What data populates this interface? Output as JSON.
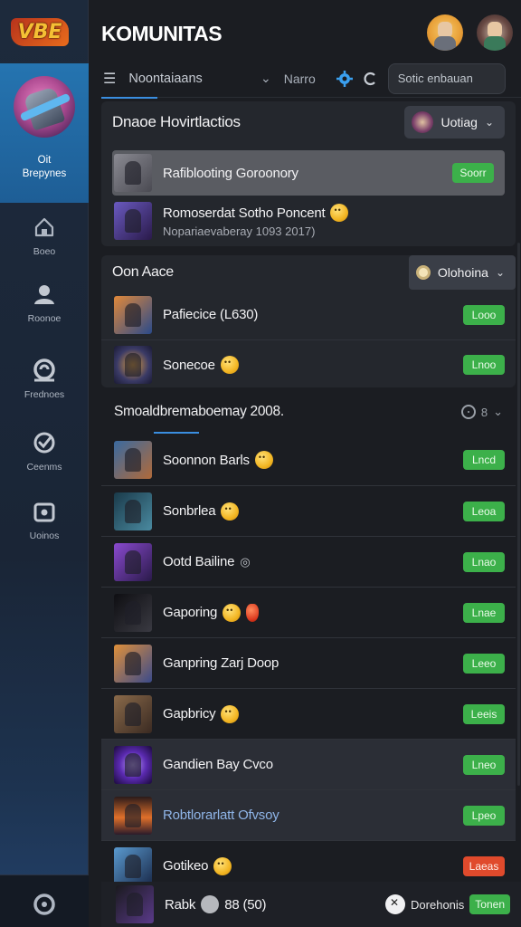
{
  "app": {
    "logo_text": "VBE",
    "title": "KOMUNITAS"
  },
  "sidebar": {
    "active": {
      "label": "Oit\nBrepynes"
    },
    "items": [
      {
        "label": "Boeo",
        "icon": "home-icon"
      },
      {
        "label": "Roonoe",
        "icon": "profile-icon"
      },
      {
        "label": "Frednoes",
        "icon": "friends-icon"
      },
      {
        "label": "Ceenms",
        "icon": "check-icon"
      },
      {
        "label": "Uoinos",
        "icon": "inbox-icon"
      }
    ]
  },
  "toolbar": {
    "tab_label": "Noontaiaans",
    "name_label": "Narro",
    "search_placeholder": "Sotic enbauan"
  },
  "panel1": {
    "title": "Dnaoe Hovirtlactios",
    "dropdown": "Uotiag",
    "rows": [
      {
        "name": "Rafiblooting Goroonory",
        "badge": "Soorr",
        "thumb": "#6a6a72"
      },
      {
        "name": "Romoserdat Sotho Poncent",
        "sub": "Nopariaevaberay 1093 2017)",
        "thumb": "#4a3a7a"
      }
    ]
  },
  "panel2": {
    "title": "Oon Aace",
    "dropdown": "Olohoina",
    "rows": [
      {
        "name": "Pafiecice (L630)",
        "badge": "Looo",
        "thumb": "#2f5a8a"
      },
      {
        "name": "Sonecoe",
        "badge": "Lnoo",
        "thumb": "#3a3a66"
      }
    ]
  },
  "section": {
    "title": "Smoaldbremaboemay 2008.",
    "count": "8"
  },
  "list": [
    {
      "name": "Soonnon Barls",
      "badge": "Lncd",
      "thumb": "#6a4a3a",
      "emoji": true
    },
    {
      "name": "Sonbrlea",
      "badge": "Leoa",
      "thumb": "#2a4a5a",
      "emoji": true
    },
    {
      "name": "Ootd Bailine",
      "badge": "Lnao",
      "thumb": "#5a2a7a",
      "circle": true
    },
    {
      "name": "Gaporing",
      "badge": "Lnae",
      "thumb": "#1a1a1e",
      "emoji": true,
      "red": true
    },
    {
      "name": "Ganpring Zarj Doop",
      "badge": "Leeo",
      "thumb": "#8a5a3a"
    },
    {
      "name": "Gapbricy",
      "badge": "Leeis",
      "thumb": "#5a4a3a",
      "emoji": true
    },
    {
      "name": "Gandien Bay Cvco",
      "badge": "Lneo",
      "thumb": "#4a2a8a"
    },
    {
      "name": "Robtlorarlatt Ofvsoy",
      "badge": "Lpeo",
      "thumb": "#9a4a1a",
      "blue": true
    },
    {
      "name": "Gotikeo",
      "badge": "Laeas",
      "thumb": "#3a5a8a",
      "emoji": true,
      "badge_red": true
    }
  ],
  "footer": {
    "name": "Rabk",
    "value": "88 (50)",
    "right_label": "Dorehonis",
    "badge": "Tonen"
  },
  "colors": {
    "accent": "#3a8ee0",
    "badge_green": "#3cb04a",
    "badge_red": "#e04a2c",
    "sidebar_active": "#2574b0"
  }
}
